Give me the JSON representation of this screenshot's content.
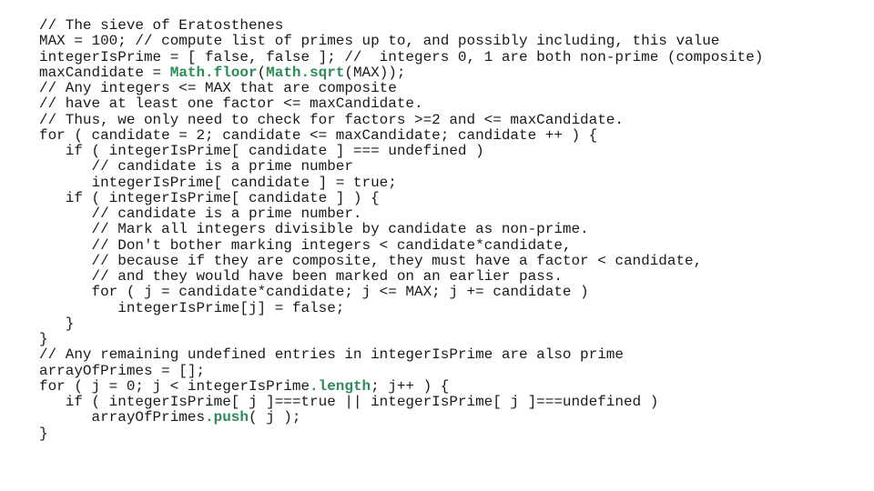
{
  "slide": {
    "accent_color": "#2e8b57",
    "code_lines": [
      [
        {
          "t": "// The sieve of Eratosthenes"
        }
      ],
      [
        {
          "t": "MAX = 100; // compute list of primes up to, and possibly including, this value"
        }
      ],
      [
        {
          "t": "integerIsPrime = [ false, false ]; //  integers 0, 1 are both non-prime (composite)"
        }
      ],
      [
        {
          "t": "maxCandidate = "
        },
        {
          "t": "Math.floor",
          "hl": true
        },
        {
          "t": "("
        },
        {
          "t": "Math.sqrt",
          "hl": true
        },
        {
          "t": "(MAX));"
        }
      ],
      [
        {
          "t": "// Any integers <= MAX that are composite"
        }
      ],
      [
        {
          "t": "// have at least one factor <= maxCandidate."
        }
      ],
      [
        {
          "t": "// Thus, we only need to check for factors >=2 and <= maxCandidate."
        }
      ],
      [
        {
          "t": "for ( candidate = 2; candidate <= maxCandidate; candidate ++ ) {"
        }
      ],
      [
        {
          "t": "   if ( integerIsPrime[ candidate ] === undefined )"
        }
      ],
      [
        {
          "t": "      // candidate is a prime number"
        }
      ],
      [
        {
          "t": "      integerIsPrime[ candidate ] = true;"
        }
      ],
      [
        {
          "t": "   if ( integerIsPrime[ candidate ] ) {"
        }
      ],
      [
        {
          "t": "      // candidate is a prime number."
        }
      ],
      [
        {
          "t": "      // Mark all integers divisible by candidate as non-prime."
        }
      ],
      [
        {
          "t": "      // Don't bother marking integers < candidate*candidate,"
        }
      ],
      [
        {
          "t": "      // because if they are composite, they must have a factor < candidate,"
        }
      ],
      [
        {
          "t": "      // and they would have been marked on an earlier pass."
        }
      ],
      [
        {
          "t": "      for ( j = candidate*candidate; j <= MAX; j += candidate )"
        }
      ],
      [
        {
          "t": "         integerIsPrime[j] = false;"
        }
      ],
      [
        {
          "t": "   }"
        }
      ],
      [
        {
          "t": "}"
        }
      ],
      [
        {
          "t": "// Any remaining undefined entries in integerIsPrime are also prime"
        }
      ],
      [
        {
          "t": "arrayOfPrimes = [];"
        }
      ],
      [
        {
          "t": "for ( j = 0; j < integerIsPrime"
        },
        {
          "t": ".length",
          "hl": true
        },
        {
          "t": "; j++ ) {"
        }
      ],
      [
        {
          "t": "   if ( integerIsPrime[ j ]===true || integerIsPrime[ j ]===undefined )"
        }
      ],
      [
        {
          "t": "      arrayOfPrimes"
        },
        {
          "t": ".push",
          "hl": true
        },
        {
          "t": "( j );"
        }
      ],
      [
        {
          "t": "}"
        }
      ]
    ]
  }
}
